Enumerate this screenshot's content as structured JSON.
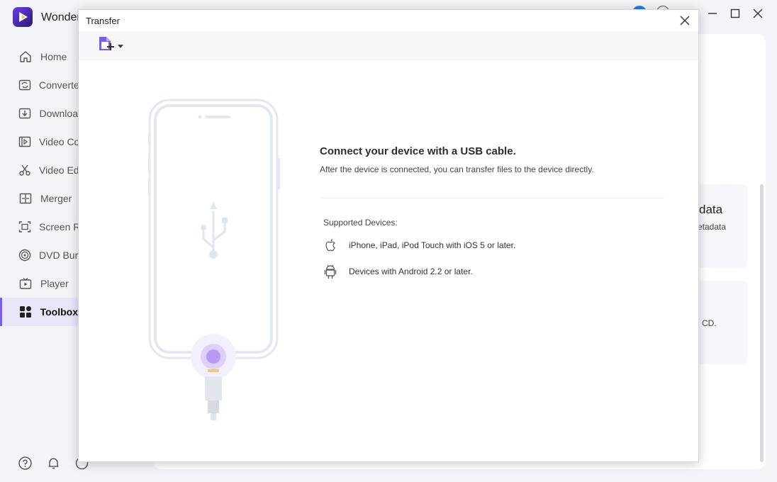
{
  "app": {
    "title": "Wonder",
    "sidebar": {
      "items": [
        {
          "label": "Home",
          "icon": "home-icon"
        },
        {
          "label": "Converte",
          "icon": "convert-icon"
        },
        {
          "label": "Downloa",
          "icon": "download-icon"
        },
        {
          "label": "Video Co",
          "icon": "compress-icon"
        },
        {
          "label": "Video Ed",
          "icon": "scissors-icon"
        },
        {
          "label": "Merger",
          "icon": "merge-icon"
        },
        {
          "label": "Screen R",
          "icon": "screen-record-icon"
        },
        {
          "label": "DVD Bur",
          "icon": "disc-icon"
        },
        {
          "label": "Player",
          "icon": "player-icon"
        },
        {
          "label": "Toolbox",
          "icon": "grid-icon",
          "active": true
        }
      ]
    },
    "cards": {
      "metadata_title": "data",
      "metadata_sub": "etadata",
      "cd_sub": "CD."
    }
  },
  "modal": {
    "title": "Transfer",
    "connect_title": "Connect your device with a USB cable.",
    "connect_desc": "After the device is connected, you can transfer files to the device directly.",
    "supported_label": "Supported Devices:",
    "devices": [
      {
        "label": "iPhone, iPad, iPod Touch with iOS 5 or later.",
        "icon": "apple-icon"
      },
      {
        "label": "Devices with Android 2.2 or later.",
        "icon": "android-icon"
      }
    ]
  },
  "colors": {
    "accent": "#7b5cf0",
    "connector_glow": "#b89af5",
    "phone_outline": "#e3e7f3"
  }
}
